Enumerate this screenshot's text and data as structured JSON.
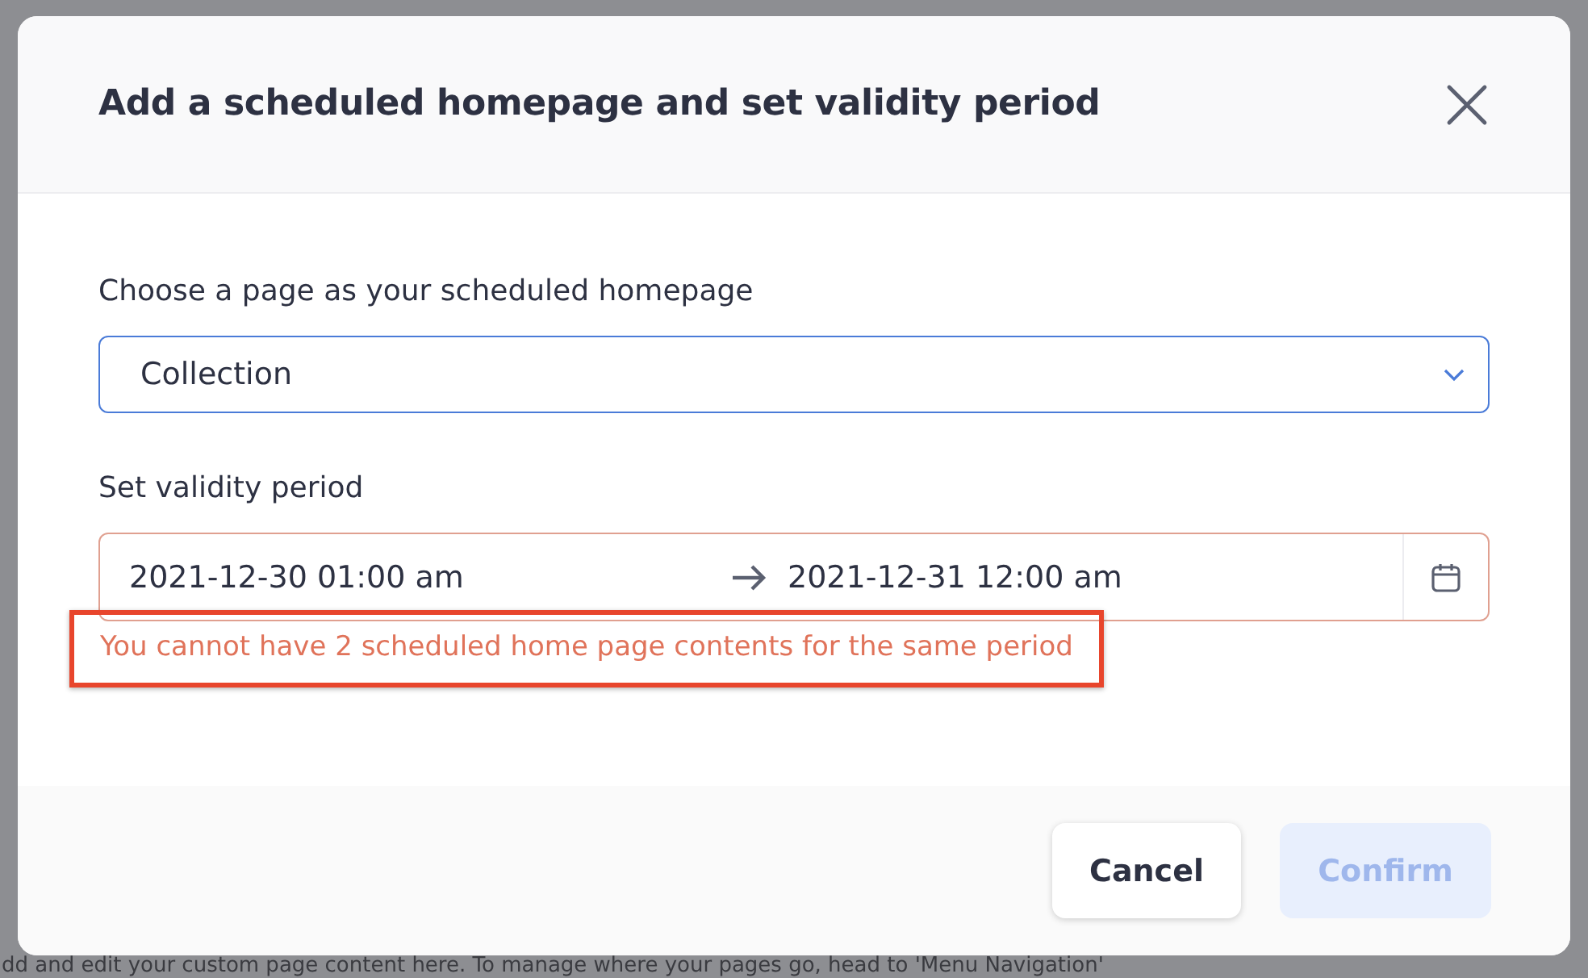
{
  "dialog": {
    "title": "Add a scheduled homepage and set validity period",
    "page_field": {
      "label": "Choose a page as your scheduled homepage",
      "value": "Collection",
      "focused": true
    },
    "validity_field": {
      "label": "Set validity period",
      "start": "2021-12-30 01:00 am",
      "end": "2021-12-31 12:00 am",
      "error": "You cannot have 2 scheduled home page contents for the same period",
      "highlighted": true
    },
    "buttons": [
      {
        "label": "Cancel",
        "kind": "secondary",
        "disabled": false
      },
      {
        "label": "Confirm",
        "kind": "primary",
        "disabled": true
      }
    ]
  },
  "background": {
    "description": "dd and edit your custom page content here. To manage where your pages go, head to 'Menu Navigation'"
  }
}
